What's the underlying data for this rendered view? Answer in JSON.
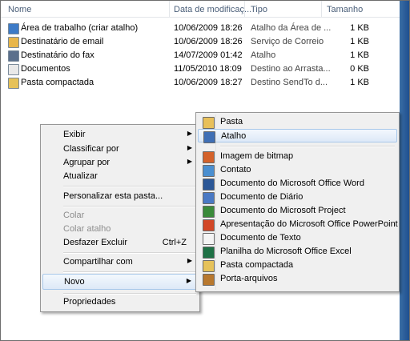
{
  "columns": {
    "name": "Nome",
    "date": "Data de modificaç...",
    "type": "Tipo",
    "size": "Tamanho"
  },
  "files": [
    {
      "name": "Área de trabalho (criar atalho)",
      "date": "10/06/2009 18:26",
      "type": "Atalho da Área de ...",
      "size": "1 KB",
      "icon": "desktop-shortcut-icon",
      "color": "#3d7bc7"
    },
    {
      "name": "Destinatário de email",
      "date": "10/06/2009 18:26",
      "type": "Serviço de Correio",
      "size": "1 KB",
      "icon": "mail-recipient-icon",
      "color": "#e8b64a"
    },
    {
      "name": "Destinatário do fax",
      "date": "14/07/2009 01:42",
      "type": "Atalho",
      "size": "1 KB",
      "icon": "fax-icon",
      "color": "#5a6f8c"
    },
    {
      "name": "Documentos",
      "date": "11/05/2010 18:09",
      "type": "Destino ao Arrasta...",
      "size": "0 KB",
      "icon": "documents-icon",
      "color": "#e9e9e9"
    },
    {
      "name": "Pasta compactada",
      "date": "10/06/2009 18:27",
      "type": "Destino SendTo d...",
      "size": "1 KB",
      "icon": "zip-folder-icon",
      "color": "#e6c25a"
    }
  ],
  "context_menu": {
    "view": "Exibir",
    "sort": "Classificar por",
    "group": "Agrupar por",
    "refresh": "Atualizar",
    "customize": "Personalizar esta pasta...",
    "paste": "Colar",
    "paste_shortcut": "Colar atalho",
    "undo": "Desfazer Excluir",
    "undo_key": "Ctrl+Z",
    "share": "Compartilhar com",
    "new": "Novo",
    "properties": "Propriedades"
  },
  "new_menu": [
    {
      "label": "Pasta",
      "icon": "folder-icon",
      "color": "#e8c05a"
    },
    {
      "label": "Atalho",
      "icon": "shortcut-icon",
      "color": "#3f6fb5"
    },
    {
      "label": "Imagem de bitmap",
      "icon": "bitmap-icon",
      "color": "#d4622a"
    },
    {
      "label": "Contato",
      "icon": "contact-icon",
      "color": "#4a8fd0"
    },
    {
      "label": "Documento do Microsoft Office Word",
      "icon": "word-icon",
      "color": "#2b5797"
    },
    {
      "label": "Documento de Diário",
      "icon": "journal-icon",
      "color": "#4a79c4"
    },
    {
      "label": "Documento do Microsoft Project",
      "icon": "project-icon",
      "color": "#3a8a3a"
    },
    {
      "label": "Apresentação do Microsoft Office PowerPoint",
      "icon": "powerpoint-icon",
      "color": "#d24726"
    },
    {
      "label": "Documento de Texto",
      "icon": "text-document-icon",
      "color": "#f4f4f4"
    },
    {
      "label": "Planilha do Microsoft Office Excel",
      "icon": "excel-icon",
      "color": "#1e7145"
    },
    {
      "label": "Pasta compactada",
      "icon": "zip-folder-icon",
      "color": "#e6c25a"
    },
    {
      "label": "Porta-arquivos",
      "icon": "briefcase-icon",
      "color": "#b8782e"
    }
  ]
}
